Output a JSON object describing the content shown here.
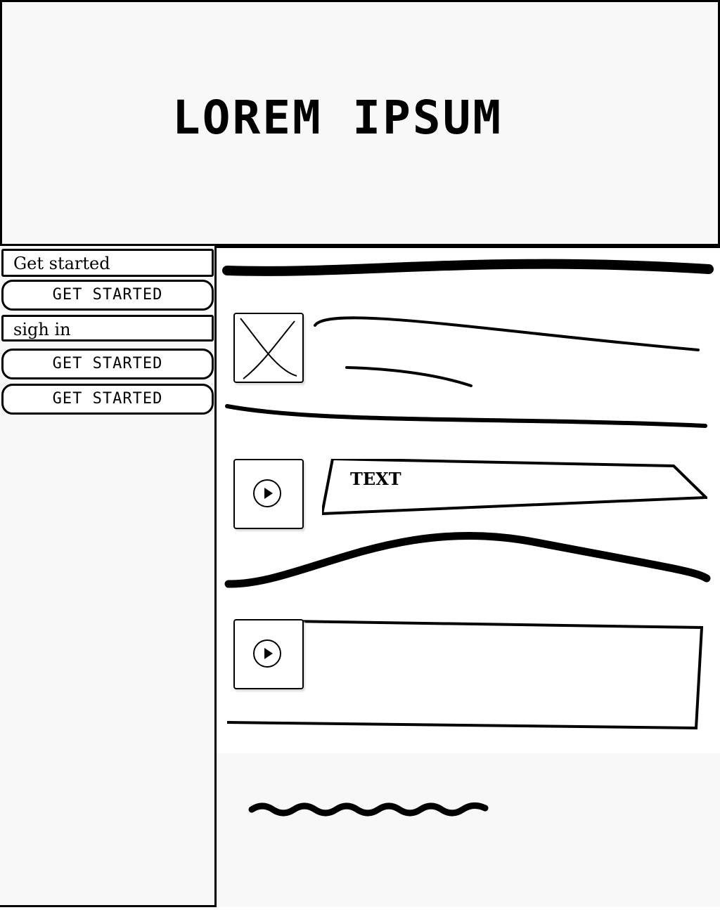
{
  "header": {
    "logo_text": "LOREM IPSUM"
  },
  "sidebar": {
    "items": [
      {
        "kind": "text",
        "label": "Get started"
      },
      {
        "kind": "button",
        "label": "GET STARTED"
      },
      {
        "kind": "text",
        "label": "sigh in"
      },
      {
        "kind": "button",
        "label": "GET STARTED"
      },
      {
        "kind": "button",
        "label": "GET STARTED"
      }
    ]
  },
  "main": {
    "text_input": {
      "value": "TEXT"
    }
  },
  "icons": {
    "image": "image-placeholder-icon",
    "video": "play-icon"
  }
}
